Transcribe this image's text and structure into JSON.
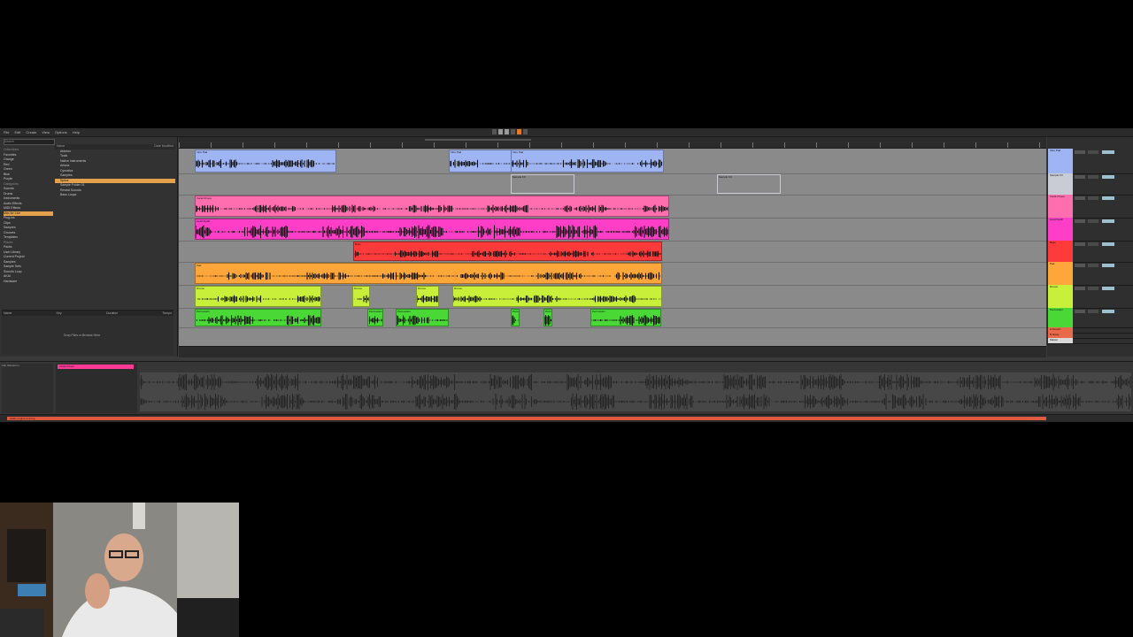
{
  "menu": [
    "File",
    "Edit",
    "Create",
    "View",
    "Options",
    "Help"
  ],
  "browser": {
    "search_placeholder": "Search",
    "places_header": "Collections",
    "places": [
      "Favorites",
      "Orange",
      "Red",
      "Green",
      "Blue",
      "Purple"
    ],
    "categories_header": "Categories",
    "categories": [
      "Sounds",
      "Drums",
      "Instruments",
      "Audio Effects",
      "MIDI Effects",
      "Max for Live",
      "Plug-ins",
      "Clips",
      "Samples",
      "Grooves",
      "Templates"
    ],
    "places2_header": "Places",
    "places2": [
      "Packs",
      "User Library",
      "Current Project",
      "Samples",
      "Sample Sets",
      "Sounds Loop",
      "AKAI",
      "Hardware"
    ],
    "columns": {
      "name": "Name",
      "date_modified": "Date Modified"
    },
    "files": [
      "Ableton",
      "Tools",
      "Native Instruments",
      "Arturia",
      "Cymatics",
      "Samples",
      "Splice",
      "Sample Folder 01",
      "Reveal Sounds",
      "Bass Loops"
    ],
    "selected_file_index": 6,
    "bottom_columns": [
      "Name",
      "Key",
      "Duration",
      "Tempo"
    ],
    "bottom_empty": "Drop Files or Browse Here"
  },
  "tracks": [
    {
      "name": "Intro Pad",
      "color": "#9fb4f2"
    },
    {
      "name": "Sample FX",
      "color": "#c9ccd4"
    },
    {
      "name": "Vocal Chops",
      "color": "#ff6fb0"
    },
    {
      "name": "Lead Synth",
      "color": "#ff3ec8"
    },
    {
      "name": "Bass",
      "color": "#ff3a3a"
    },
    {
      "name": "Pad",
      "color": "#ffa63a"
    },
    {
      "name": "Drums",
      "color": "#c8f03a"
    },
    {
      "name": "Percussion",
      "color": "#49d836"
    }
  ],
  "mixer": {
    "returns": [
      "A Reverb",
      "B Delay"
    ],
    "master_label": "Master"
  },
  "detail": {
    "clip_name": "Vocal Chops",
    "info_text": "Clip Waveform"
  },
  "status": {
    "message": "Audio engine running"
  }
}
